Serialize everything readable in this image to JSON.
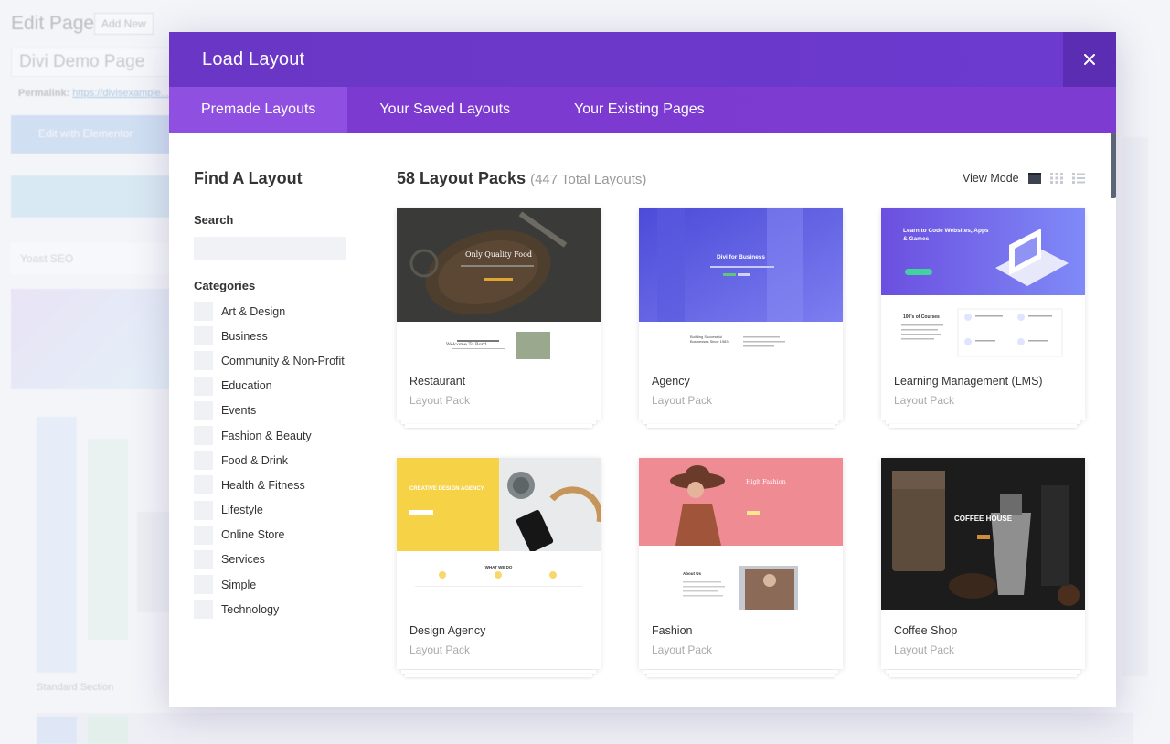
{
  "background": {
    "title": "Edit Page",
    "add_new": "Add New",
    "page_title": "Divi Demo Page",
    "permalink_label": "Permalink:",
    "permalink_url": "https://divisexample...",
    "edit_elementor": "Edit with Elementor",
    "yoast": "Yoast SEO",
    "standard_section": "Standard Section"
  },
  "modal": {
    "title": "Load Layout",
    "close_icon": "close-icon",
    "tabs": [
      {
        "label": "Premade Layouts",
        "active": true
      },
      {
        "label": "Your Saved Layouts",
        "active": false
      },
      {
        "label": "Your Existing Pages",
        "active": false
      }
    ]
  },
  "sidebar": {
    "title": "Find A Layout",
    "search_label": "Search",
    "search_placeholder": "",
    "categories_label": "Categories",
    "categories": [
      "Art & Design",
      "Business",
      "Community & Non-Profit",
      "Education",
      "Events",
      "Fashion & Beauty",
      "Food & Drink",
      "Health & Fitness",
      "Lifestyle",
      "Online Store",
      "Services",
      "Simple",
      "Technology"
    ]
  },
  "main": {
    "packs_count": "58 Layout Packs",
    "total_layouts": "(447 Total Layouts)",
    "view_mode_label": "View Mode",
    "view_mode_icons": [
      "single-view-icon",
      "grid-view-icon",
      "list-view-icon"
    ],
    "cards": [
      {
        "name": "Restaurant",
        "type": "Layout Pack",
        "thumb_text": "Only Quality Food",
        "thumb_sub": "Welcome To Bord"
      },
      {
        "name": "Agency",
        "type": "Layout Pack",
        "thumb_text": "Divi for Business",
        "thumb_sub": "Building Successful Businesses Since 1983"
      },
      {
        "name": "Learning Management (LMS)",
        "type": "Layout Pack",
        "thumb_text": "Learn to Code Websites, Apps & Games",
        "thumb_sub": "100's of Courses"
      },
      {
        "name": "Design Agency",
        "type": "Layout Pack",
        "thumb_text": "CREATIVE DESIGN AGENCY",
        "thumb_sub": "WHAT WE DO"
      },
      {
        "name": "Fashion",
        "type": "Layout Pack",
        "thumb_text": "High Fashion",
        "thumb_sub": "About Us"
      },
      {
        "name": "Coffee Shop",
        "type": "Layout Pack",
        "thumb_text": "COFFEE HOUSE",
        "thumb_sub": ""
      }
    ]
  },
  "colors": {
    "header": "#6a36c5",
    "tabs": "#7d3bd2",
    "active_tab": "#8f4fe0",
    "close_bg": "#5a2db3"
  }
}
